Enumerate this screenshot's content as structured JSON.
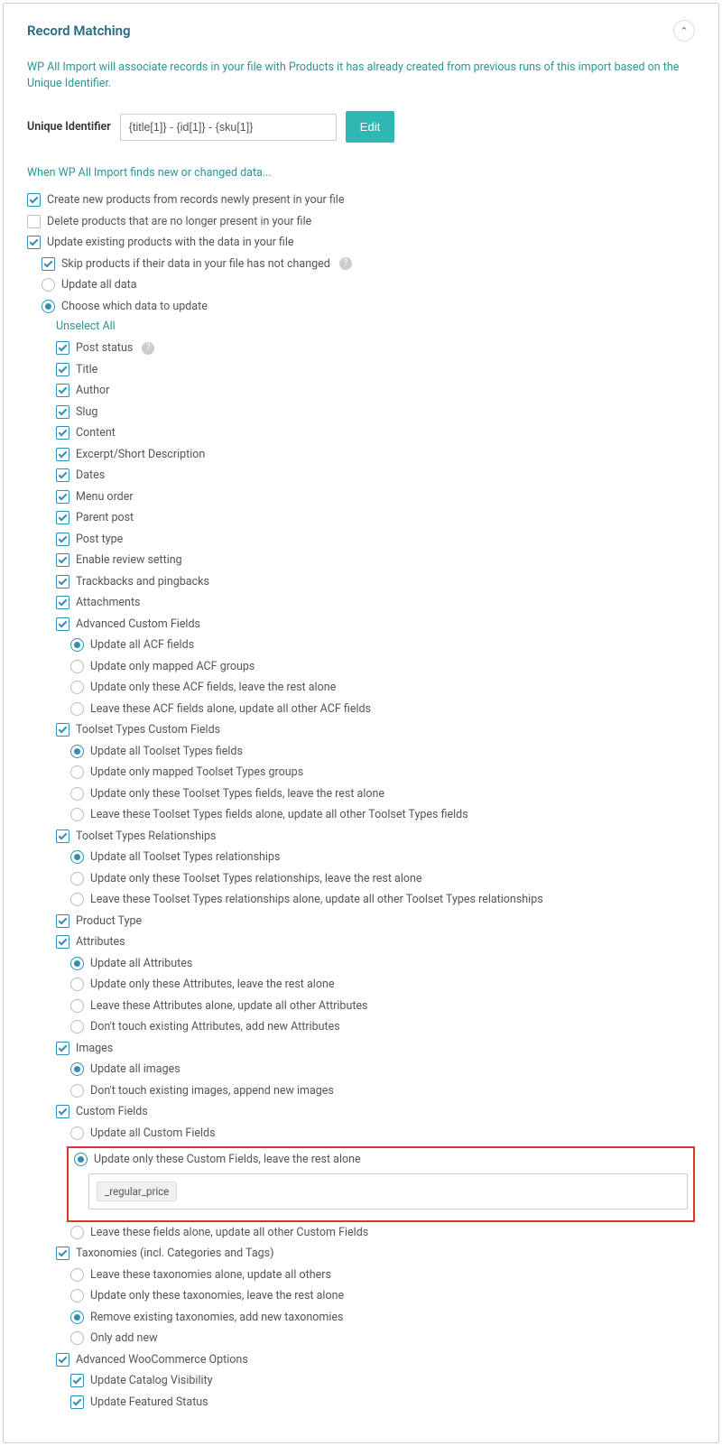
{
  "panel": {
    "title": "Record Matching"
  },
  "intro": "WP All Import will associate records in your file with Products it has already created from previous runs of this import based on the Unique Identifier.",
  "identifier": {
    "label": "Unique Identifier",
    "value": "{title[1]} - {id[1]} - {sku[1]}",
    "edit": "Edit"
  },
  "subhead": "When WP All Import finds new or changed data...",
  "top": {
    "create": "Create new products from records newly present in your file",
    "delete": "Delete products that are no longer present in your file",
    "update": "Update existing products with the data in your file"
  },
  "update_opts": {
    "skip": "Skip products if their data in your file has not changed",
    "update_all": "Update all data",
    "choose": "Choose which data to update"
  },
  "unselect": "Unselect All",
  "fields": {
    "post_status": "Post status",
    "title": "Title",
    "author": "Author",
    "slug": "Slug",
    "content": "Content",
    "excerpt": "Excerpt/Short Description",
    "dates": "Dates",
    "menu_order": "Menu order",
    "parent_post": "Parent post",
    "post_type": "Post type",
    "reviews": "Enable review setting",
    "trackbacks": "Trackbacks and pingbacks",
    "attachments": "Attachments",
    "acf": "Advanced Custom Fields",
    "toolset_cf": "Toolset Types Custom Fields",
    "toolset_rel": "Toolset Types Relationships",
    "product_type": "Product Type",
    "attributes": "Attributes",
    "images": "Images",
    "custom_fields": "Custom Fields",
    "taxonomies": "Taxonomies (incl. Categories and Tags)",
    "woo": "Advanced WooCommerce Options"
  },
  "acf_opts": {
    "all": "Update all ACF fields",
    "mapped": "Update only mapped ACF groups",
    "only": "Update only these ACF fields, leave the rest alone",
    "leave": "Leave these ACF fields alone, update all other ACF fields"
  },
  "toolset_cf_opts": {
    "all": "Update all Toolset Types fields",
    "mapped": "Update only mapped Toolset Types groups",
    "only": "Update only these Toolset Types fields, leave the rest alone",
    "leave": "Leave these Toolset Types fields alone, update all other Toolset Types fields"
  },
  "toolset_rel_opts": {
    "all": "Update all Toolset Types relationships",
    "only": "Update only these Toolset Types relationships, leave the rest alone",
    "leave": "Leave these Toolset Types relationships alone, update all other Toolset Types relationships"
  },
  "attr_opts": {
    "all": "Update all Attributes",
    "only": "Update only these Attributes, leave the rest alone",
    "leave": "Leave these Attributes alone, update all other Attributes",
    "dont": "Don't touch existing Attributes, add new Attributes"
  },
  "img_opts": {
    "all": "Update all images",
    "dont": "Don't touch existing images, append new images"
  },
  "cf_opts": {
    "all": "Update all Custom Fields",
    "only": "Update only these Custom Fields, leave the rest alone",
    "leave": "Leave these fields alone, update all other Custom Fields",
    "tag": "_regular_price"
  },
  "tax_opts": {
    "leave": "Leave these taxonomies alone, update all others",
    "only": "Update only these taxonomies, leave the rest alone",
    "remove": "Remove existing taxonomies, add new taxonomies",
    "add": "Only add new"
  },
  "woo_opts": {
    "catalog": "Update Catalog Visibility",
    "featured": "Update Featured Status"
  }
}
